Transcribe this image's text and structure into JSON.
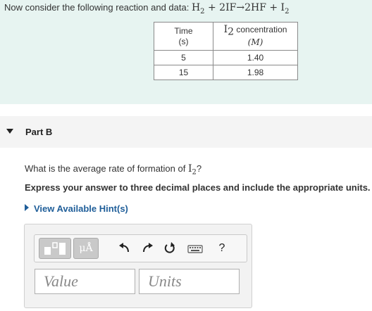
{
  "intro": {
    "text": "Now consider the following reaction and data:",
    "equation": {
      "r1": "H",
      "r1_sub": "2",
      "plus1": " + 2IF",
      "arrow": "→",
      "p1": "2HF + I",
      "p1_sub": "2"
    }
  },
  "table": {
    "col1_header": "Time",
    "col1_unit": "(s)",
    "col2_header_prefix": "I",
    "col2_header_sub": "2",
    "col2_header_suffix": " concentration",
    "col2_unit": "(M)",
    "rows": [
      {
        "time": "5",
        "conc": "1.40"
      },
      {
        "time": "15",
        "conc": "1.98"
      }
    ]
  },
  "part": {
    "label": "Part B"
  },
  "question": {
    "prefix": "What is the average rate of formation of ",
    "species": "I",
    "species_sub": "2",
    "suffix": "?"
  },
  "instruction": "Express your answer to three decimal places and include the appropriate units.",
  "hint_link": "View Available Hint(s)",
  "toolbar": {
    "units_label": "μÅ",
    "help_label": "?"
  },
  "answer": {
    "value_placeholder": "Value",
    "units_placeholder": "Units"
  },
  "colors": {
    "intro_bg": "#e7f4f1",
    "link": "#1f5e99"
  }
}
